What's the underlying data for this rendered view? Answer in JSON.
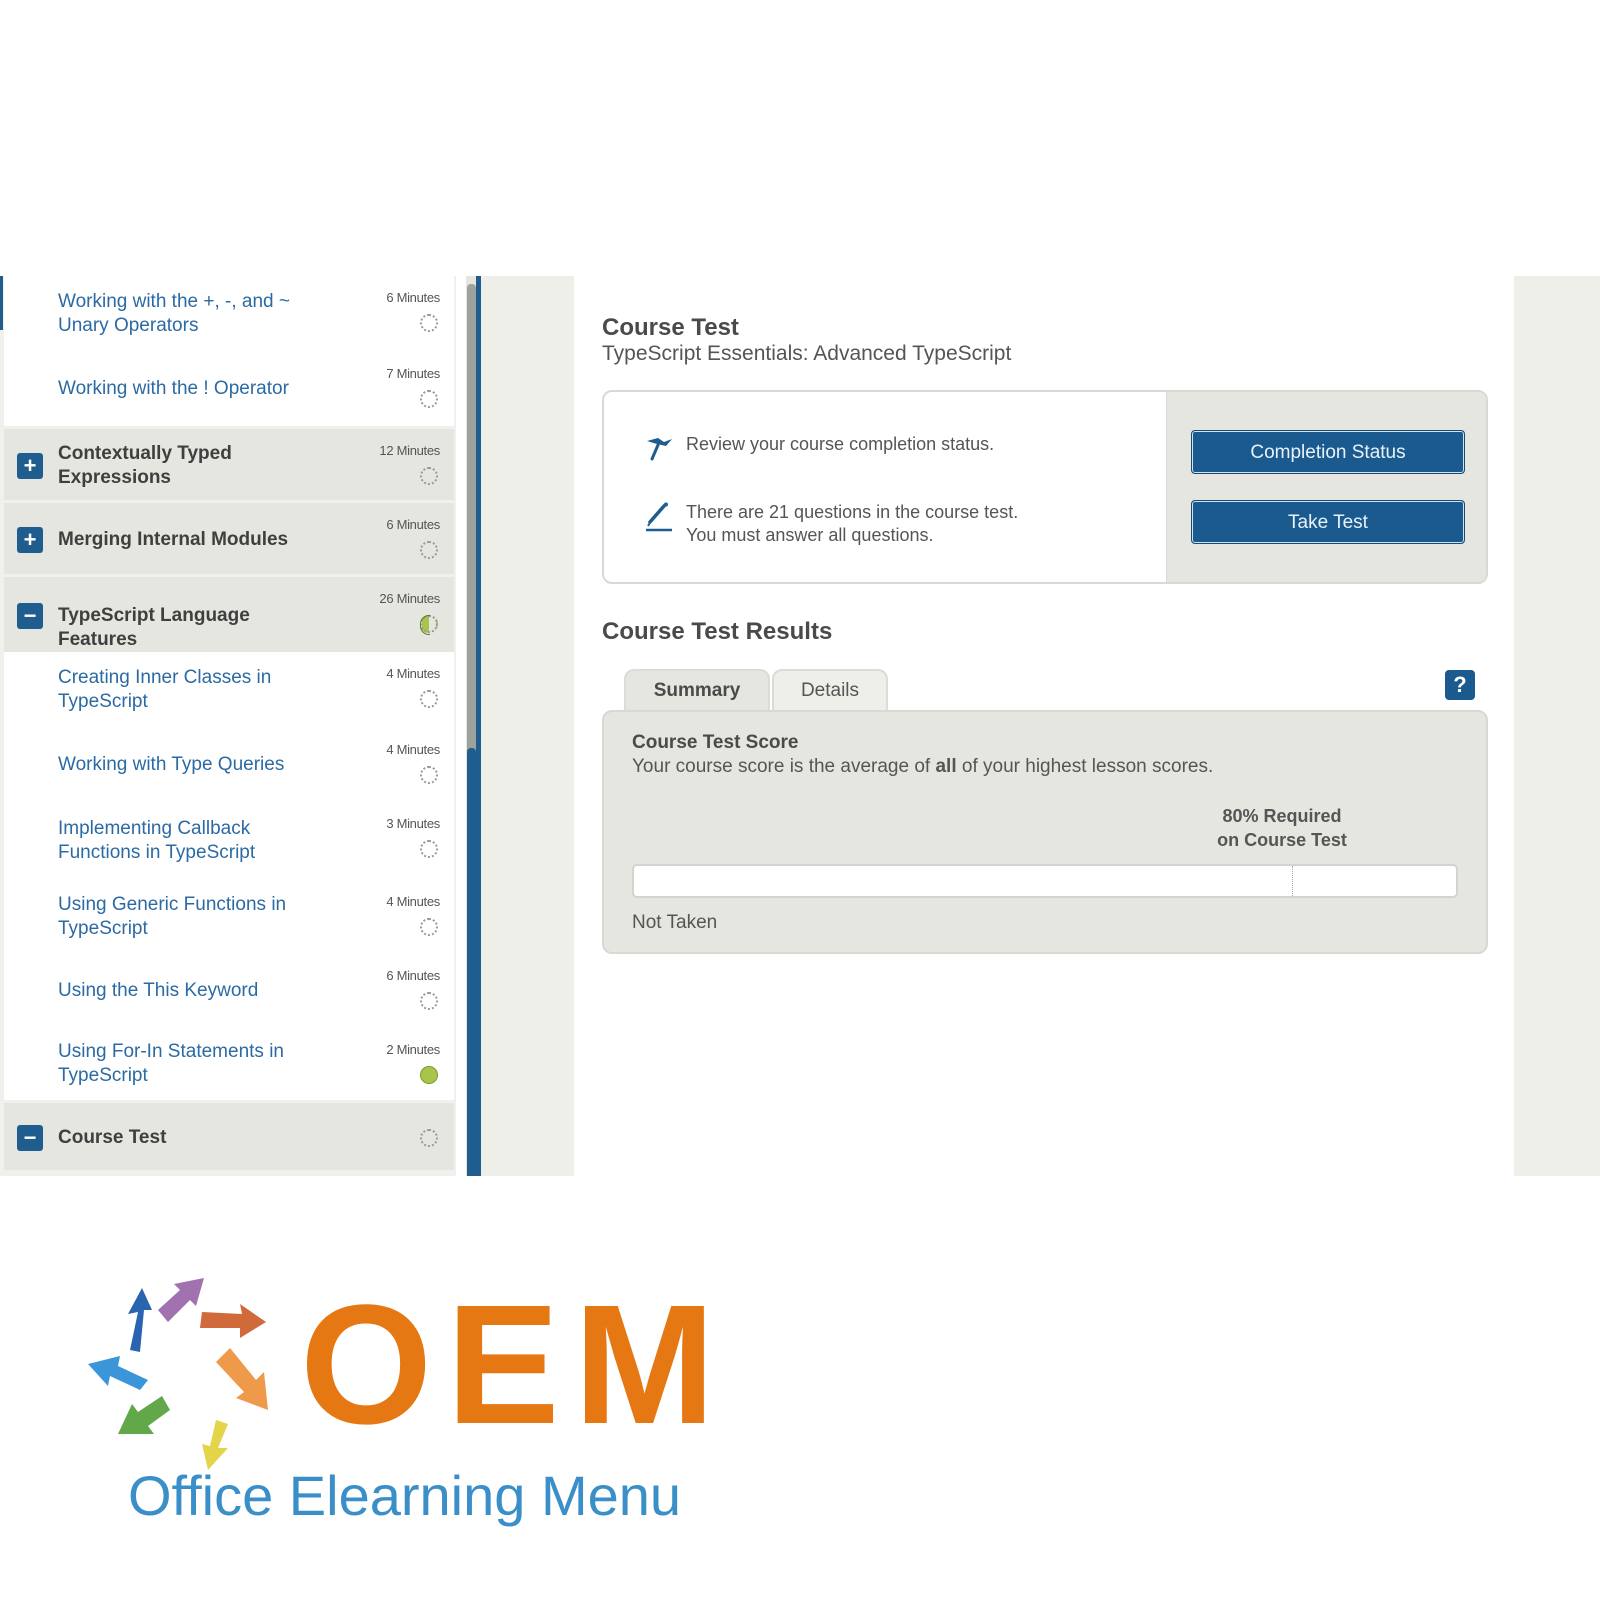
{
  "sidebar": {
    "items": [
      {
        "kind": "lesson",
        "title": "Working with the +, -, and ~ Unary Operators",
        "duration": "6 Minutes",
        "status": "not-started"
      },
      {
        "kind": "lesson",
        "title": "Working with the ! Operator",
        "duration": "7 Minutes",
        "status": "not-started"
      },
      {
        "kind": "module",
        "toggle": "+",
        "title": "Contextually Typed Expressions",
        "duration": "12 Minutes",
        "status": "not-started"
      },
      {
        "kind": "module",
        "toggle": "+",
        "title": "Merging Internal Modules",
        "duration": "6 Minutes",
        "status": "not-started"
      },
      {
        "kind": "module",
        "toggle": "−",
        "title": "TypeScript Language Features",
        "duration": "26 Minutes",
        "status": "in-progress"
      },
      {
        "kind": "lesson",
        "title": "Creating Inner Classes in TypeScript",
        "duration": "4 Minutes",
        "status": "not-started"
      },
      {
        "kind": "lesson",
        "title": "Working with Type Queries",
        "duration": "4 Minutes",
        "status": "not-started"
      },
      {
        "kind": "lesson",
        "title": "Implementing Callback Functions in TypeScript",
        "duration": "3 Minutes",
        "status": "not-started"
      },
      {
        "kind": "lesson",
        "title": "Using Generic Functions in TypeScript",
        "duration": "4 Minutes",
        "status": "not-started"
      },
      {
        "kind": "lesson",
        "title": "Using the This Keyword",
        "duration": "6 Minutes",
        "status": "not-started"
      },
      {
        "kind": "lesson",
        "title": "Using For-In Statements in TypeScript",
        "duration": "2 Minutes",
        "status": "completed"
      },
      {
        "kind": "module",
        "toggle": "−",
        "title": "Course Test",
        "duration": "",
        "status": "not-started"
      }
    ]
  },
  "main": {
    "title": "Course Test",
    "subtitle": "TypeScript Essentials: Advanced TypeScript",
    "info": {
      "review_text": "Review your course completion status.",
      "questions_line1": "There are 21 questions in the course test.",
      "questions_line2": "You must answer all questions.",
      "review_icon": "flag-icon",
      "questions_icon": "pencil-icon"
    },
    "buttons": {
      "completion_status": "Completion Status",
      "take_test": "Take Test"
    },
    "results": {
      "title": "Course Test Results",
      "tabs": [
        {
          "label": "Summary",
          "active": true
        },
        {
          "label": "Details",
          "active": false
        }
      ],
      "help_label": "?",
      "score_title": "Course Test Score",
      "score_desc_before": "Your course score is the average of ",
      "score_desc_bold": "all",
      "score_desc_after": " of your highest lesson scores.",
      "required_line1": "80% Required",
      "required_line2": "on Course Test",
      "required_percent": 80,
      "score_percent": 0,
      "status": "Not Taken"
    }
  },
  "logo": {
    "wordmark": "OEM",
    "tagline": "Office Elearning Menu"
  },
  "colors": {
    "brand_blue": "#1f5d8f",
    "link_blue": "#2b6aa3",
    "complete_green": "#a8c44a",
    "logo_orange": "#e67814",
    "logo_blue": "#3a8fc8"
  }
}
